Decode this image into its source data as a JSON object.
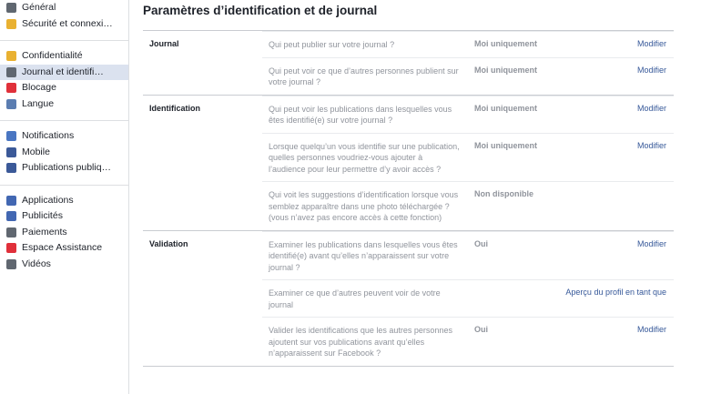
{
  "sidebar": {
    "groups": [
      [
        {
          "label": "Général",
          "icon": "gears-icon",
          "color": "#606770"
        },
        {
          "label": "Sécurité et connexi…",
          "icon": "shield-key-icon",
          "color": "#e9b131"
        }
      ],
      [
        {
          "label": "Confidentialité",
          "icon": "lock-icon",
          "color": "#e9b131"
        },
        {
          "label": "Journal et identifi…",
          "icon": "timeline-icon",
          "color": "#606770",
          "active": true
        },
        {
          "label": "Blocage",
          "icon": "block-icon",
          "color": "#e0303a"
        },
        {
          "label": "Langue",
          "icon": "language-icon",
          "color": "#5b7db1"
        }
      ],
      [
        {
          "label": "Notifications",
          "icon": "globe-icon",
          "color": "#4a76c2"
        },
        {
          "label": "Mobile",
          "icon": "mobile-icon",
          "color": "#3b5998"
        },
        {
          "label": "Publications publiq…",
          "icon": "rss-icon",
          "color": "#3b5998"
        }
      ],
      [
        {
          "label": "Applications",
          "icon": "apps-icon",
          "color": "#4267b2"
        },
        {
          "label": "Publicités",
          "icon": "ads-icon",
          "color": "#4267b2"
        },
        {
          "label": "Paiements",
          "icon": "payments-icon",
          "color": "#606770"
        },
        {
          "label": "Espace Assistance",
          "icon": "lifebuoy-icon",
          "color": "#e0303a"
        },
        {
          "label": "Vidéos",
          "icon": "film-icon",
          "color": "#606770"
        }
      ]
    ]
  },
  "main": {
    "title": "Paramètres d’identification et de journal",
    "sections": [
      {
        "label": "Journal",
        "rows": [
          {
            "question": "Qui peut publier sur votre journal ?",
            "value": "Moi uniquement",
            "action": "Modifier"
          },
          {
            "question": "Qui peut voir ce que d’autres personnes publient sur votre journal ?",
            "value": "Moi uniquement",
            "action": "Modifier"
          }
        ]
      },
      {
        "label": "Identification",
        "rows": [
          {
            "question": "Qui peut voir les publications dans lesquelles vous êtes identifié(e) sur votre journal ?",
            "value": "Moi uniquement",
            "action": "Modifier"
          },
          {
            "question": "Lorsque quelqu’un vous identifie sur une publication, quelles personnes voudriez-vous ajouter à l’audience pour leur permettre d’y avoir accès ?",
            "value": "Moi uniquement",
            "action": "Modifier"
          },
          {
            "question": "Qui voit les suggestions d’identification lorsque vous semblez apparaître dans une photo téléchargée ? (vous n’avez pas encore accès à cette fonction)",
            "value": "Non disponible",
            "action": ""
          }
        ]
      },
      {
        "label": "Validation",
        "rows": [
          {
            "question": "Examiner les publications dans lesquelles vous êtes identifié(e) avant qu’elles n’apparaissent sur votre journal ?",
            "value": "Oui",
            "action": "Modifier"
          },
          {
            "question": "Examiner ce que d’autres peuvent voir de votre journal",
            "value": "",
            "action": "Aperçu du profil en tant que"
          },
          {
            "question": "Valider les identifications que les autres personnes ajoutent sur vos publications avant qu’elles n’apparaissent sur Facebook ?",
            "value": "Oui",
            "action": "Modifier"
          }
        ]
      }
    ]
  }
}
